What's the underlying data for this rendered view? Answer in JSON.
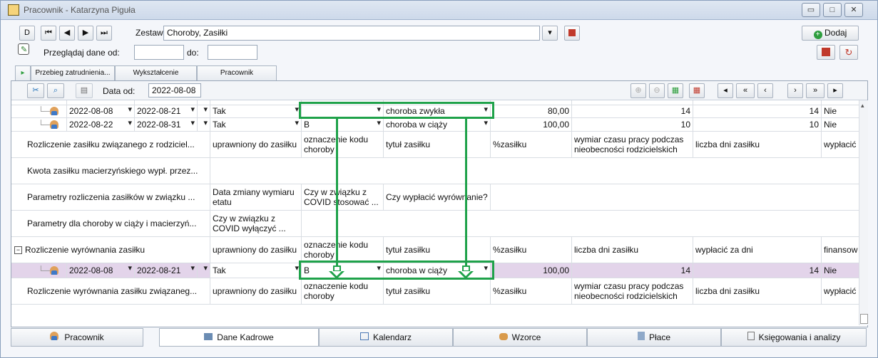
{
  "window": {
    "title": "Pracownik - Katarzyna Piguła"
  },
  "nav": {
    "d_label": "D",
    "first": "⏮",
    "prev": "◀",
    "next": "▶",
    "last": "⏭"
  },
  "zestaw": {
    "label": "Zestaw:",
    "value": "Choroby, Zasiłki"
  },
  "add_button": {
    "label": "Dodaj"
  },
  "filter": {
    "label": "Przeglądaj dane od:",
    "to_label": "do:",
    "from_value": "",
    "to_value": ""
  },
  "top_tabs": [
    "Przebieg zatrudnienia...",
    "Wykształcenie",
    "Pracownik"
  ],
  "toolbar": {
    "date_label": "Data od:",
    "date_value": "2022-08-08"
  },
  "rows": {
    "r1": {
      "from": "2022-08-08",
      "to": "2022-08-21",
      "flag": "Tak",
      "code": "",
      "title": "choroba zwykła",
      "pct": "80,00",
      "days": "14",
      "days2": "14",
      "pay": "Nie"
    },
    "r2": {
      "from": "2022-08-22",
      "to": "2022-08-31",
      "flag": "Tak",
      "code": "B",
      "title": "choroba w ciąży",
      "pct": "100,00",
      "days": "10",
      "days2": "10",
      "pay": "Nie"
    },
    "h1": {
      "label": "Rozliczenie zasiłku związanego z rodziciel...",
      "c1": "uprawniony do zasiłku",
      "c2": "oznaczenie kodu choroby",
      "c3": "tytuł zasiłku",
      "c4": "%zasiłku",
      "c5": "wymiar czasu pracy podczas nieobecności rodzicielskich",
      "c6": "liczba dni zasiłku",
      "c7": "wypłacić"
    },
    "h2": {
      "label": "Kwota zasiłku macierzyńskiego wypł. przez..."
    },
    "h3": {
      "label": "Parametry rozliczenia zasiłków w związku ...",
      "c1": "Data zmiany wymiaru etatu",
      "c2": "Czy w związku z COVID stosować ...",
      "c3": "Czy wypłacić wyrównanie?"
    },
    "h4": {
      "label": "Parametry dla choroby w ciąży i macierzyń...",
      "c1": "Czy w związku z COVID wyłączyć ..."
    },
    "h5": {
      "label": "Rozliczenie wyrównania zasiłku",
      "c1": "uprawniony do zasiłku",
      "c2": "oznaczenie kodu choroby",
      "c3": "tytuł zasiłku",
      "c4": "%zasiłku",
      "c5": "liczba dni zasiłku",
      "c6": "wypłacić za dni",
      "c7": "finansow"
    },
    "r3": {
      "from": "2022-08-08",
      "to": "2022-08-21",
      "flag": "Tak",
      "code": "B",
      "title": "choroba w ciąży",
      "pct": "100,00",
      "days": "14",
      "days2": "14",
      "pay": "Nie"
    },
    "h6": {
      "label": "Rozliczenie wyrównania zasiłku związaneg...",
      "c1": "uprawniony do zasiłku",
      "c2": "oznaczenie kodu choroby",
      "c3": "tytuł zasiłku",
      "c4": "%zasiłku",
      "c5": "wymiar czasu pracy podczas nieobecności rodzicielskich",
      "c6": "liczba dni zasiłku",
      "c7": "wypłacić"
    }
  },
  "bottom_tabs": [
    "Pracownik",
    "Dane Kadrowe",
    "Kalendarz",
    "Wzorce",
    "Płace",
    "Księgowania i analizy"
  ],
  "colors": {
    "highlight": "#e3d4ea",
    "annotation": "#1fa24a"
  }
}
